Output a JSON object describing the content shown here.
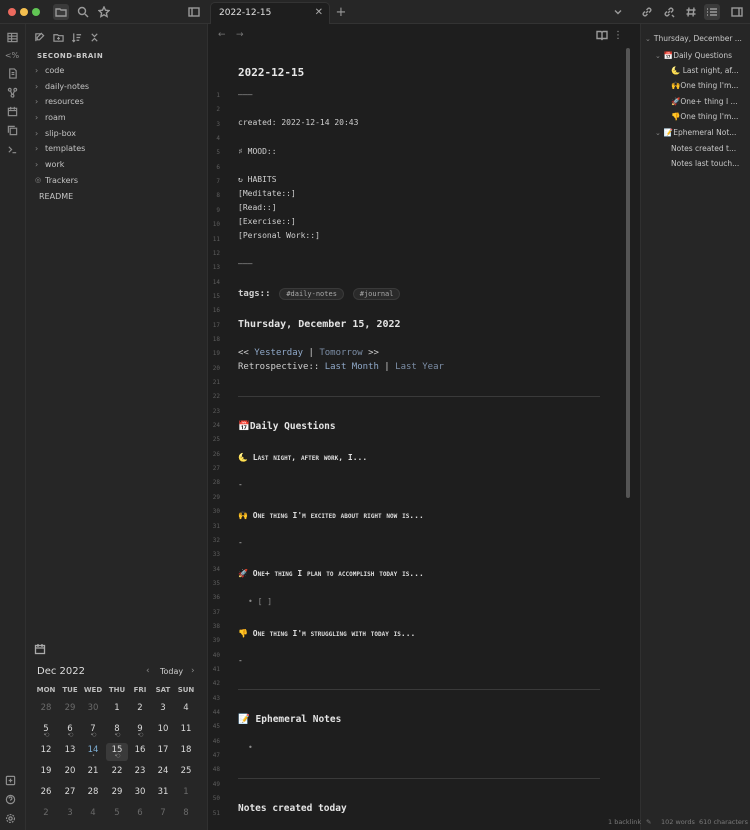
{
  "window": {
    "traffic": [
      "#ec6a5e",
      "#f4bf4f",
      "#61c554"
    ]
  },
  "tab": {
    "title": "2022-12-15"
  },
  "sidebar": {
    "vault": "SECOND-BRAIN",
    "items": [
      {
        "label": "code",
        "chev": "›"
      },
      {
        "label": "daily-notes",
        "chev": "›"
      },
      {
        "label": "resources",
        "chev": "›"
      },
      {
        "label": "roam",
        "chev": "›"
      },
      {
        "label": "slip-box",
        "chev": "›"
      },
      {
        "label": "templates",
        "chev": "›"
      },
      {
        "label": "work",
        "chev": "›"
      },
      {
        "label": "Trackers",
        "chev": "◎"
      },
      {
        "label": "README",
        "chev": ""
      }
    ]
  },
  "calendar": {
    "title": "Dec 2022",
    "today_label": "Today",
    "prev": "‹",
    "next": "›",
    "dow": [
      "MON",
      "TUE",
      "WED",
      "THU",
      "FRI",
      "SAT",
      "SUN"
    ],
    "weeks": [
      [
        "28",
        "29",
        "30",
        "1",
        "2",
        "3",
        "4"
      ],
      [
        "5",
        "6",
        "7",
        "8",
        "9",
        "10",
        "11"
      ],
      [
        "12",
        "13",
        "14",
        "15",
        "16",
        "17",
        "18"
      ],
      [
        "19",
        "20",
        "21",
        "22",
        "23",
        "24",
        "25"
      ],
      [
        "26",
        "27",
        "28",
        "29",
        "30",
        "31",
        "1"
      ],
      [
        "2",
        "3",
        "4",
        "5",
        "6",
        "7",
        "8"
      ]
    ]
  },
  "editor": {
    "title": "2022-12-15",
    "lines": {
      "l3": "created: 2022-12-14 20:43",
      "l5": "♯ MOOD::",
      "l7": "↻ HABITS",
      "l8": "[Meditate::]",
      "l9": "[Read::]",
      "l10": "[Exercise::]",
      "l11": "[Personal Work::]",
      "l15": "tags::",
      "tag1": "#daily-notes",
      "tag2": "#journal",
      "l17": "Thursday, December 15, 2022",
      "l19a": "<< ",
      "l19b": "Yesterday",
      "l19c": " | ",
      "l19d": "Tomorrow",
      "l19e": " >>",
      "l20a": "Retrospective:: ",
      "l20b": "Last Month",
      "l20c": " | ",
      "l20d": "Last Year",
      "l24": "📅Daily Questions",
      "l26": "🌜 Last night, after work, I...",
      "l28": "-",
      "l30": "🙌 One thing I'm excited about right now is...",
      "l32": "-",
      "l34": "🚀 One+ thing I plan to accomplish today is...",
      "l36": "•  [ ]",
      "l38": "👎 One thing I'm struggling with today is...",
      "l40": "-",
      "l44": "📝 Ephemeral Notes",
      "l46": "•",
      "l50": "Notes created today"
    },
    "hr1": "———",
    "hr2": "———",
    "line_numbers": [
      "1",
      "2",
      "3",
      "4",
      "5",
      "6",
      "7",
      "8",
      "9",
      "10",
      "11",
      "12",
      "13",
      "14",
      "15",
      "16",
      "17",
      "18",
      "19",
      "20",
      "21",
      "22",
      "23",
      "24",
      "25",
      "26",
      "27",
      "28",
      "29",
      "30",
      "31",
      "32",
      "33",
      "34",
      "35",
      "36",
      "37",
      "38",
      "39",
      "40",
      "41",
      "42",
      "43",
      "44",
      "45",
      "46",
      "47",
      "48",
      "49",
      "50",
      "51"
    ]
  },
  "outline": {
    "root": "Thursday, December ...",
    "items": [
      {
        "label": "📅Daily Questions",
        "level": 1,
        "chev": "⌄"
      },
      {
        "label": "🌜 Last night, af...",
        "level": 2
      },
      {
        "label": "🙌One thing I'm...",
        "level": 2
      },
      {
        "label": "🚀One+ thing I ...",
        "level": 2
      },
      {
        "label": "👎One thing I'm...",
        "level": 2
      },
      {
        "label": "📝Ephemeral Not...",
        "level": 1,
        "chev": "⌄"
      },
      {
        "label": "Notes created t...",
        "level": 2
      },
      {
        "label": "Notes last touch...",
        "level": 2
      }
    ]
  },
  "status": {
    "backlinks": "1 backlink",
    "words": "102 words",
    "chars": "610 characters"
  }
}
